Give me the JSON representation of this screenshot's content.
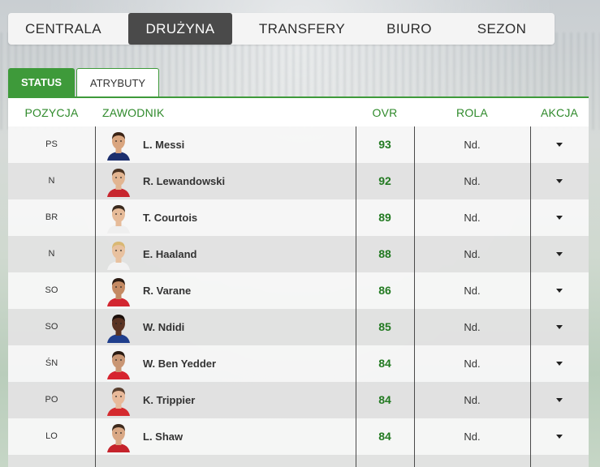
{
  "nav": {
    "items": [
      {
        "label": "CENTRALA",
        "active": false
      },
      {
        "label": "DRUŻYNA",
        "active": true
      },
      {
        "label": "TRANSFERY",
        "active": false
      },
      {
        "label": "BIURO",
        "active": false
      },
      {
        "label": "SEZON",
        "active": false
      }
    ]
  },
  "subtabs": {
    "status": "STATUS",
    "attributes": "ATRYBUTY"
  },
  "table": {
    "headers": {
      "position": "POZYCJA",
      "player": "ZAWODNIK",
      "ovr": "OVR",
      "role": "ROLA",
      "action": "AKCJA"
    },
    "rows": [
      {
        "position": "PS",
        "name": "L. Messi",
        "ovr": "93",
        "role": "Nd.",
        "skin": "#d9a57f",
        "hair": "#3b2416",
        "shirt": "#1c2f6e"
      },
      {
        "position": "N",
        "name": "R. Lewandowski",
        "ovr": "92",
        "role": "Nd.",
        "skin": "#e2b591",
        "hair": "#4a3322",
        "shirt": "#c7262e"
      },
      {
        "position": "BR",
        "name": "T. Courtois",
        "ovr": "89",
        "role": "Nd.",
        "skin": "#e6bb99",
        "hair": "#3a2a1e",
        "shirt": "#efefef"
      },
      {
        "position": "N",
        "name": "E. Haaland",
        "ovr": "88",
        "role": "Nd.",
        "skin": "#e8c19f",
        "hair": "#d9b874",
        "shirt": "#f2f2f2"
      },
      {
        "position": "SO",
        "name": "R. Varane",
        "ovr": "86",
        "role": "Nd.",
        "skin": "#c48a63",
        "hair": "#2b1b12",
        "shirt": "#d22630"
      },
      {
        "position": "SO",
        "name": "W. Ndidi",
        "ovr": "85",
        "role": "Nd.",
        "skin": "#5a3322",
        "hair": "#1a0f0a",
        "shirt": "#1f3e8c"
      },
      {
        "position": "ŚN",
        "name": "W. Ben Yedder",
        "ovr": "84",
        "role": "Nd.",
        "skin": "#c99674",
        "hair": "#2a1b12",
        "shirt": "#d6242f"
      },
      {
        "position": "PO",
        "name": "K. Trippier",
        "ovr": "84",
        "role": "Nd.",
        "skin": "#e8b99a",
        "hair": "#5a4030",
        "shirt": "#d42a2e"
      },
      {
        "position": "LO",
        "name": "L. Shaw",
        "ovr": "84",
        "role": "Nd.",
        "skin": "#d9a885",
        "hair": "#3d2a1d",
        "shirt": "#c5232b"
      }
    ]
  }
}
